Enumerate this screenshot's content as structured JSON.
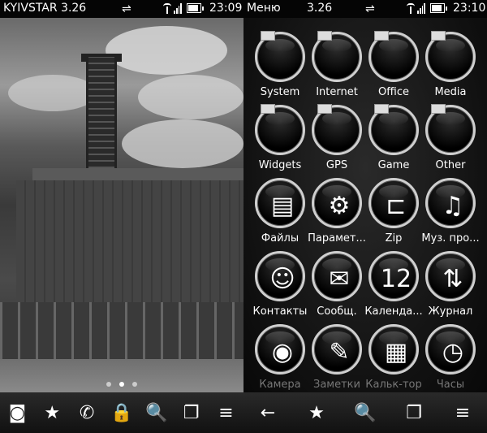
{
  "left_screen": {
    "status": {
      "operator": "KYIVSTAR 3.26",
      "usb_icon": "usb-icon",
      "time": "23:09"
    },
    "page_indicator": {
      "count": 3,
      "active": 2
    },
    "toolbar": {
      "items": [
        {
          "name": "app-grid-icon",
          "glyph": "◙"
        },
        {
          "name": "favorites-icon",
          "glyph": "★"
        },
        {
          "name": "phone-icon",
          "glyph": "✆"
        },
        {
          "name": "lock-icon",
          "glyph": "🔒"
        },
        {
          "name": "search-icon",
          "glyph": "🔍"
        },
        {
          "name": "task-switcher-icon",
          "glyph": "❐"
        },
        {
          "name": "menu-icon",
          "glyph": "≡"
        }
      ]
    }
  },
  "right_screen": {
    "status": {
      "title": "Меню",
      "version": "3.26",
      "usb_icon": "usb-icon",
      "time": "23:10"
    },
    "grid": [
      {
        "label": "System",
        "icon": "folder-icon",
        "glyph": ""
      },
      {
        "label": "Internet",
        "icon": "folder-icon",
        "glyph": ""
      },
      {
        "label": "Office",
        "icon": "folder-icon",
        "glyph": ""
      },
      {
        "label": "Media",
        "icon": "folder-icon",
        "glyph": ""
      },
      {
        "label": "Widgets",
        "icon": "folder-icon",
        "glyph": ""
      },
      {
        "label": "GPS",
        "icon": "folder-icon",
        "glyph": ""
      },
      {
        "label": "Game",
        "icon": "folder-icon",
        "glyph": ""
      },
      {
        "label": "Other",
        "icon": "folder-icon",
        "glyph": ""
      },
      {
        "label": "Файлы",
        "icon": "files-icon",
        "glyph": "▤"
      },
      {
        "label": "Парамет...",
        "icon": "settings-gears-icon",
        "glyph": "⚙"
      },
      {
        "label": "Zip",
        "icon": "zip-clamp-icon",
        "glyph": "⊏"
      },
      {
        "label": "Муз. про...",
        "icon": "music-icon",
        "glyph": "♫"
      },
      {
        "label": "Контакты",
        "icon": "contacts-icon",
        "glyph": "☺"
      },
      {
        "label": "Сообщ.",
        "icon": "messages-icon",
        "glyph": "✉"
      },
      {
        "label": "Календа...",
        "icon": "calendar-icon",
        "glyph": "12"
      },
      {
        "label": "Журнал",
        "icon": "log-icon",
        "glyph": "⇅"
      },
      {
        "label": "Камера",
        "icon": "camera-icon",
        "glyph": "◉"
      },
      {
        "label": "Заметки",
        "icon": "notes-icon",
        "glyph": "✎"
      },
      {
        "label": "Кальк-тор",
        "icon": "calculator-icon",
        "glyph": "▦"
      },
      {
        "label": "Часы",
        "icon": "clock-icon",
        "glyph": "◷"
      }
    ],
    "toolbar": {
      "items": [
        {
          "name": "back-arrow-icon",
          "glyph": "←"
        },
        {
          "name": "favorites-icon",
          "glyph": "★"
        },
        {
          "name": "search-icon",
          "glyph": "🔍"
        },
        {
          "name": "task-switcher-icon",
          "glyph": "❐"
        },
        {
          "name": "menu-icon",
          "glyph": "≡"
        }
      ]
    }
  }
}
